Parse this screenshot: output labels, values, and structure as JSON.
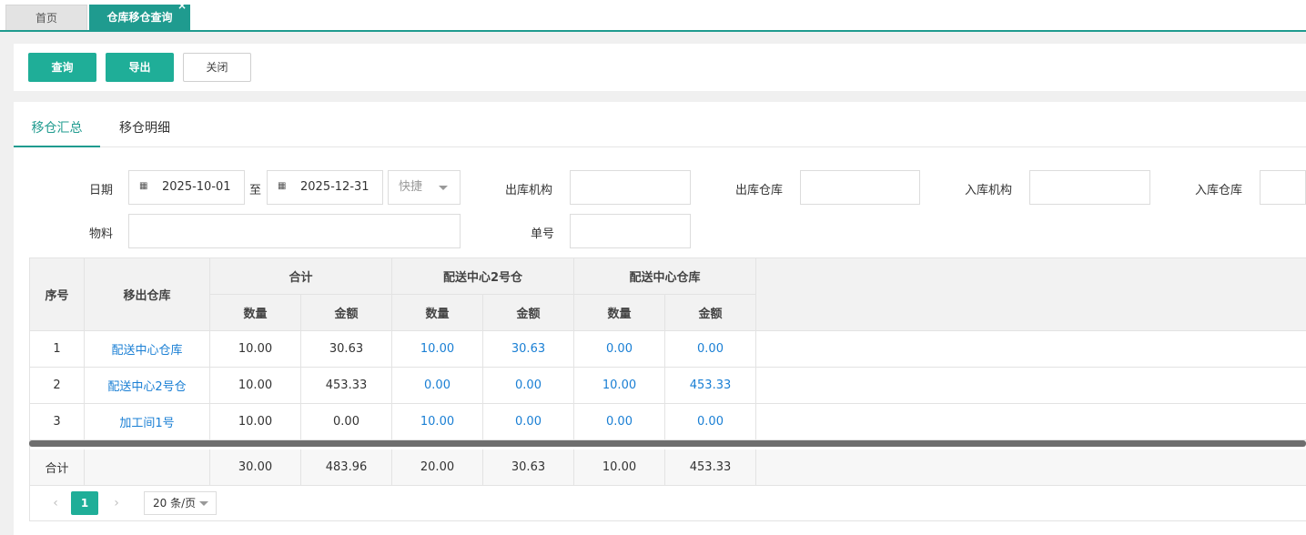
{
  "tabs": {
    "home": "首页",
    "active": "仓库移仓查询",
    "close": "×"
  },
  "toolbar": {
    "query": "查询",
    "export": "导出",
    "close": "关闭"
  },
  "subtabs": {
    "summary": "移仓汇总",
    "detail": "移仓明细"
  },
  "filters": {
    "date_label": "日期",
    "date_from": "2025-10-01",
    "date_to_sep": "至",
    "date_to": "2025-12-31",
    "quick": "快捷",
    "out_org": "出库机构",
    "out_wh": "出库仓库",
    "in_org": "入库机构",
    "in_wh": "入库仓库",
    "material": "物料",
    "order_no": "单号"
  },
  "table": {
    "h_seq": "序号",
    "h_out_wh": "移出仓库",
    "h_total": "合计",
    "h_center2": "配送中心2号仓",
    "h_center": "配送中心仓库",
    "h_qty": "数量",
    "h_amt": "金额",
    "rows": [
      {
        "seq": "1",
        "wh": "配送中心仓库",
        "t_qty": "10.00",
        "t_amt": "30.63",
        "c2_qty": "10.00",
        "c2_amt": "30.63",
        "c_qty": "0.00",
        "c_amt": "0.00"
      },
      {
        "seq": "2",
        "wh": "配送中心2号仓",
        "t_qty": "10.00",
        "t_amt": "453.33",
        "c2_qty": "0.00",
        "c2_amt": "0.00",
        "c_qty": "10.00",
        "c_amt": "453.33"
      },
      {
        "seq": "3",
        "wh": "加工间1号",
        "t_qty": "10.00",
        "t_amt": "0.00",
        "c2_qty": "10.00",
        "c2_amt": "0.00",
        "c_qty": "0.00",
        "c_amt": "0.00"
      }
    ],
    "footer": {
      "label": "合计",
      "t_qty": "30.00",
      "t_amt": "483.96",
      "c2_qty": "20.00",
      "c2_amt": "30.63",
      "c_qty": "10.00",
      "c_amt": "453.33"
    }
  },
  "pager": {
    "prev": "‹",
    "current": "1",
    "next": "›",
    "page_size": "20 条/页"
  },
  "colors": {
    "accent": "#1fae98",
    "link": "#1a7fd4"
  }
}
